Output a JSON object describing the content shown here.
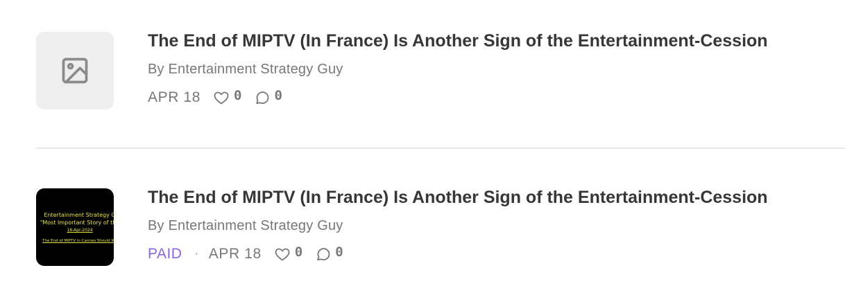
{
  "posts": [
    {
      "title": "The End of MIPTV (In France) Is Another Sign of the Entertainment-Cession",
      "author": "By Entertainment Strategy Guy",
      "date": "APR 18",
      "likes": "0",
      "comments": "0",
      "paid_label": "",
      "thumbnail": "image-placeholder-icon"
    },
    {
      "title": "The End of MIPTV (In France) Is Another Sign of the Entertainment-Cession",
      "author": "By Entertainment Strategy Guy",
      "date": "APR 18",
      "likes": "0",
      "comments": "0",
      "paid_label": "PAID",
      "separator": "·",
      "thumbnail_text": {
        "line1": "Entertainment Strategy G",
        "line2": "\"Most Important Story of the",
        "line3": "18-Apr-2024",
        "line4": "The End of MIPTV in Cannes Should Wo"
      }
    }
  ],
  "colors": {
    "title": "#363737",
    "meta": "#777777",
    "paid": "#8a63ea",
    "divider": "#e6e6e6",
    "placeholder_bg": "#eeeeee",
    "cover_bg": "#000000",
    "cover_text": "#e7e33a"
  },
  "icons": [
    "image-placeholder-icon",
    "heart-icon",
    "comment-icon"
  ]
}
